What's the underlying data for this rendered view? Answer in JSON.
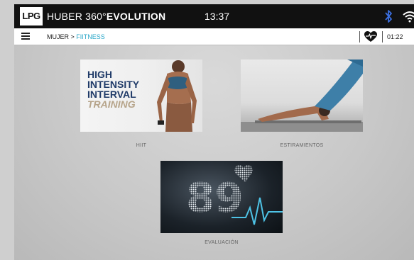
{
  "topbar": {
    "logo": "LPG",
    "brand_prefix": "HUBER 360°",
    "brand_strong": "EVOLUTION",
    "clock": "13:37"
  },
  "navbar": {
    "crumb_parent": "MUJER >",
    "crumb_current": "FIITNESS",
    "timer": "01:22"
  },
  "tiles": [
    {
      "label": "HIIT",
      "image_text": [
        "HIGH",
        "INTENSITY",
        "INTERVAL",
        "TRAINING"
      ]
    },
    {
      "label": "ESTIRAMIENTOS"
    },
    {
      "label": "EVALUACIÓN",
      "image_text": "89"
    }
  ],
  "colors": {
    "topbar_bg": "#111111",
    "accent": "#2aa7c9",
    "bluetooth": "#3b6fe0",
    "hiit_title": "#1f3a68",
    "hiit_subtitle": "#b6a48a"
  },
  "icons": {
    "menu": "hamburger-icon",
    "bluetooth": "bluetooth-icon",
    "wifi": "wifi-icon",
    "heart_rate": "heart-monitor-icon"
  }
}
